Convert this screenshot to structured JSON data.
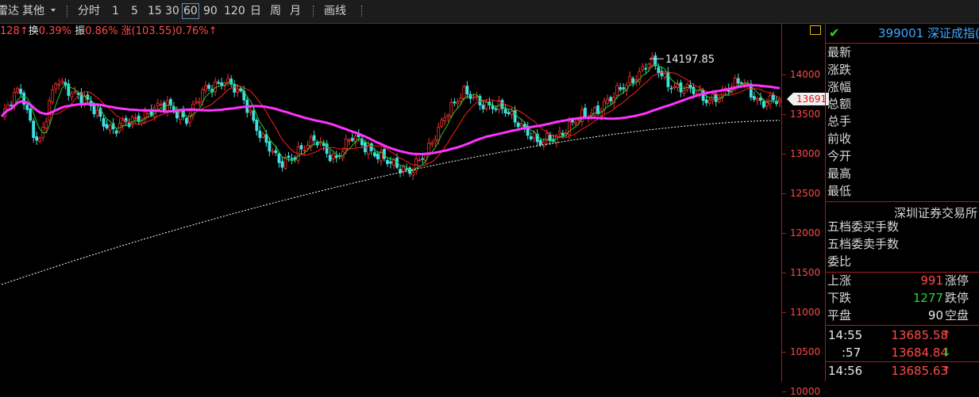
{
  "toolbar": {
    "items": [
      "雷达",
      "其他",
      "分时",
      "1",
      "5",
      "15",
      "30",
      "60",
      "90",
      "120",
      "日",
      "周",
      "月",
      "画线"
    ],
    "selected": "60"
  },
  "infoline": {
    "amount": "128↑",
    "turnover_label": "换",
    "turnover": "0.39%",
    "amp_label": "振",
    "amplitude": "0.86%",
    "change_label": "涨",
    "change": "(103.55)0.76%↑"
  },
  "chart": {
    "peak_label": "14197.85",
    "current_tag": "13691",
    "yticks": [
      "14000",
      "13500",
      "13000",
      "12500",
      "12000",
      "11500",
      "11000",
      "10500",
      "10000"
    ]
  },
  "chart_data": {
    "type": "candlestick",
    "title": "",
    "ylim": [
      10000,
      14350
    ],
    "peak": 14197.85,
    "current": 13691,
    "yticks": [
      14000,
      13500,
      13000,
      12500,
      12000,
      11500,
      11000,
      10500,
      10000
    ],
    "anchors_close": [
      13450,
      13820,
      13100,
      13950,
      13750,
      13550,
      13300,
      13400,
      13550,
      13600,
      13450,
      13800,
      13950,
      13700,
      13250,
      12850,
      13050,
      13150,
      12950,
      13200,
      13050,
      12850,
      12800,
      13000,
      13550,
      13750,
      13650,
      13550,
      13400,
      13100,
      13250,
      13400,
      13550,
      13700,
      13950,
      14150,
      13900,
      13800,
      13700,
      13750,
      13950,
      13600,
      13691
    ],
    "series": [
      {
        "name": "",
        "color": "#ff0000"
      },
      {
        "name": "",
        "color": "#00cc00"
      },
      {
        "name": "",
        "color": "#ff33ff"
      },
      {
        "name": "",
        "color": "#ffffff"
      }
    ],
    "colors": {
      "up": "#ff3030",
      "down": "#40e0e0",
      "ma_red": "#ff2020",
      "ma_green": "#22cc22",
      "ma_magenta": "#ff33ff",
      "ma_white": "#ffffff"
    }
  },
  "panel": {
    "title": "399001 深证成指(",
    "labels": [
      "最新",
      "涨跌",
      "涨幅",
      "总额",
      "总手",
      "前收",
      "今开",
      "最高",
      "最低"
    ],
    "exchange": "深圳证券交易所",
    "labels2": [
      "五档委买手数",
      "五档委卖手数",
      "委比"
    ],
    "stats": [
      {
        "label": "上涨",
        "value": "991",
        "suffix": "涨停"
      },
      {
        "label": "下跌",
        "value": "1277",
        "suffix": "跌停"
      },
      {
        "label": "平盘",
        "value": "90",
        "suffix": "空盘"
      }
    ],
    "ticks": [
      {
        "time": "14:55",
        "price": "13685.58",
        "arrow": "↑"
      },
      {
        "time": ":57",
        "price": "13684.84",
        "arrow": "↓"
      },
      {
        "time": "14:56",
        "price": "13685.63",
        "arrow": "↑"
      }
    ]
  }
}
